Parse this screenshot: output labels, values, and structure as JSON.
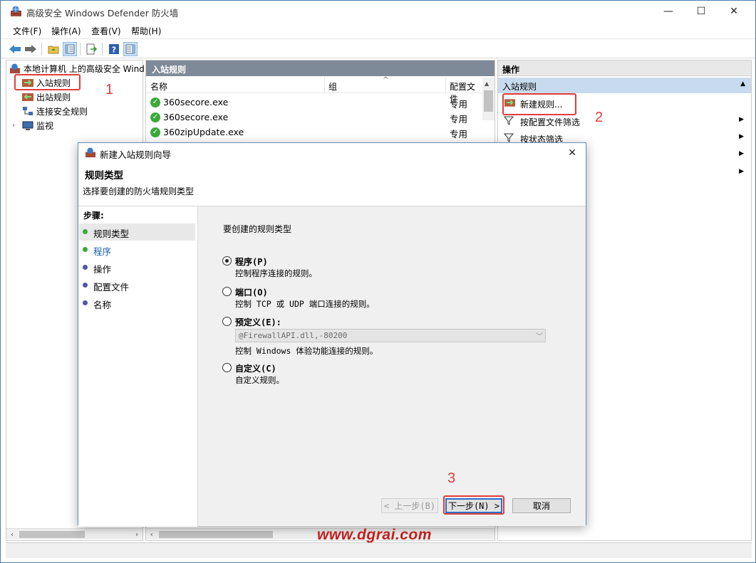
{
  "window": {
    "title": "高级安全 Windows Defender 防火墙",
    "controls": {
      "minimize": "—",
      "maximize": "☐",
      "close": "✕"
    }
  },
  "menu": [
    "文件(F)",
    "操作(A)",
    "查看(V)",
    "帮助(H)"
  ],
  "tree": {
    "root": "本地计算机 上的高级安全 Wind",
    "items": [
      "入站规则",
      "出站规则",
      "连接安全规则",
      "监视"
    ]
  },
  "list": {
    "header": "入站规则",
    "columns": [
      "名称",
      "组",
      "配置文件"
    ],
    "rows": [
      {
        "name": "360secore.exe",
        "profile": "专用"
      },
      {
        "name": "360secore.exe",
        "profile": "专用"
      },
      {
        "name": "360zipUpdate.exe",
        "profile": "专用"
      }
    ]
  },
  "actions": {
    "title": "操作",
    "section": "入站规则",
    "items": [
      "新建规则...",
      "按配置文件筛选",
      "按状态筛选"
    ]
  },
  "annotations": {
    "n1": "1",
    "n2": "2",
    "n3": "3"
  },
  "watermark": "www.dgrai.com",
  "dialog": {
    "title": "新建入站规则向导",
    "heading": "规则类型",
    "subheading": "选择要创建的防火墙规则类型",
    "steps_title": "步骤:",
    "steps": [
      "规则类型",
      "程序",
      "操作",
      "配置文件",
      "名称"
    ],
    "prompt": "要创建的规则类型",
    "options": [
      {
        "title": "程序(P)",
        "desc": "控制程序连接的规则。",
        "selected": true
      },
      {
        "title": "端口(O)",
        "desc": "控制 TCP 或 UDP 端口连接的规则。",
        "selected": false
      },
      {
        "title": "预定义(E):",
        "desc": "控制 Windows 体验功能连接的规则。",
        "selected": false
      },
      {
        "title": "自定义(C)",
        "desc": "自定义规则。",
        "selected": false
      }
    ],
    "predefined_value": "@FirewallAPI.dll,-80200",
    "buttons": {
      "back": "< 上一步(B)",
      "next": "下一步(N) >",
      "cancel": "取消"
    }
  },
  "colors": {
    "accent": "#2a73c9",
    "annotation": "#e23c3c",
    "watermark": "#c0201e",
    "step_active": "#3aa93a",
    "step_pending": "#5056a8"
  }
}
